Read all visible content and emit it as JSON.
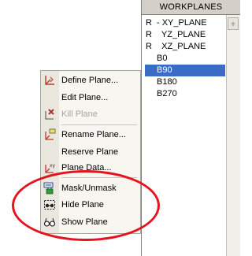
{
  "workplanes": {
    "header": "WORKPLANES",
    "rows": [
      {
        "prefix": "R",
        "name": "- XY_PLANE"
      },
      {
        "prefix": "R",
        "name": "  YZ_PLANE"
      },
      {
        "prefix": "R",
        "name": "  XZ_PLANE"
      },
      {
        "prefix": "",
        "name": "B0"
      },
      {
        "prefix": "",
        "name": "B90"
      },
      {
        "prefix": "",
        "name": "B180"
      },
      {
        "prefix": "",
        "name": "B270"
      }
    ],
    "selected": "B90"
  },
  "menu": {
    "items": [
      {
        "label": "Define Plane...",
        "icon": "define-plane-icon",
        "disabled": false
      },
      {
        "label": "Edit Plane...",
        "icon": "",
        "disabled": false
      },
      {
        "label": "Kill Plane",
        "icon": "kill-plane-icon",
        "disabled": true
      },
      {
        "label": "Rename Plane...",
        "icon": "rename-plane-icon",
        "disabled": false
      },
      {
        "label": "Reserve Plane",
        "icon": "",
        "disabled": false
      },
      {
        "label": "Plane Data...",
        "icon": "plane-data-icon",
        "disabled": false
      },
      {
        "label": "Mask/Unmask",
        "icon": "mask-icon",
        "disabled": false
      },
      {
        "label": "Hide Plane",
        "icon": "hide-plane-icon",
        "disabled": false
      },
      {
        "label": "Show Plane",
        "icon": "show-plane-icon",
        "disabled": false
      }
    ]
  },
  "colors": {
    "selection": "#3a6cc5",
    "highlight_ellipse": "#e3141d",
    "icon_accent": "#c0392b"
  }
}
